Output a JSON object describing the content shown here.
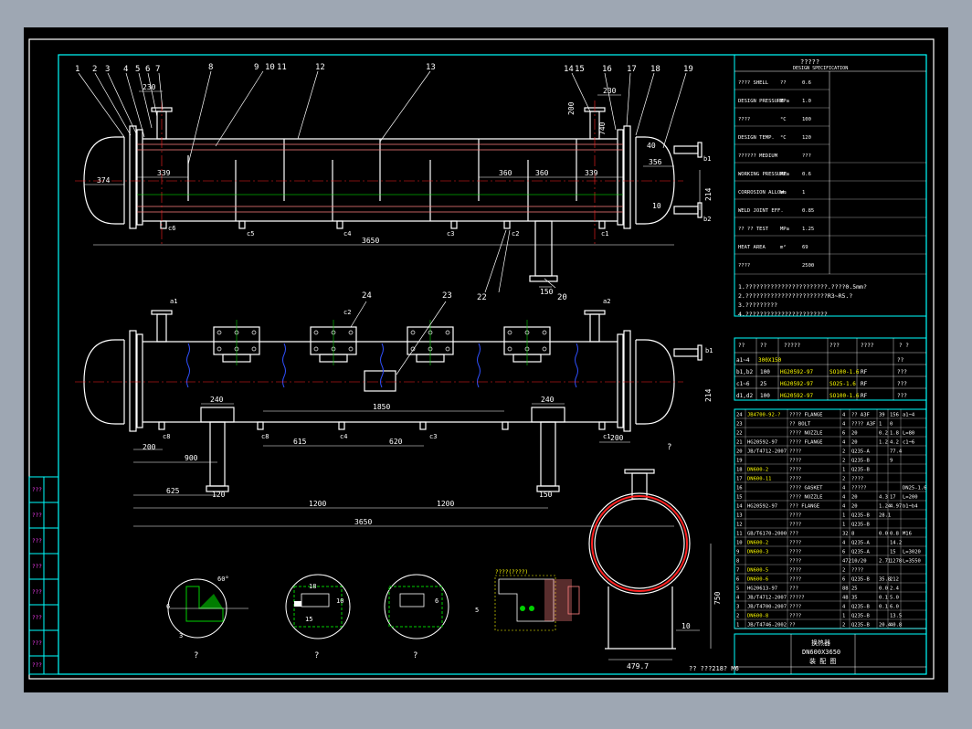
{
  "drawing": {
    "title_line1": "换热器",
    "title_line2": "DN600X3650",
    "title_line3": "装 配 图",
    "scale_note": "?? ???218? M6",
    "question": "?"
  },
  "balloons": [
    "1",
    "2",
    "3",
    "4",
    "5",
    "6",
    "7",
    "8",
    "9",
    "10",
    "11",
    "12",
    "13",
    "14",
    "15",
    "16",
    "17",
    "18",
    "19"
  ],
  "balloons_lower": [
    "24",
    "23",
    "21",
    "22",
    "20"
  ],
  "front_dims": {
    "d374": "374",
    "d339a": "339",
    "d360a": "360",
    "d360b": "360",
    "d339b": "339",
    "d3650": "3650",
    "d230a": "230",
    "d230b": "230",
    "d200": "200",
    "d740": "740",
    "d40": "40",
    "d356": "356",
    "d214": "214",
    "d10": "10",
    "d150": "150",
    "d20": "20"
  },
  "nozzles_top": [
    "c6",
    "c5",
    "c4",
    "c3",
    "c2",
    "c1",
    "b1",
    "b2"
  ],
  "plan_dims": {
    "d240a": "240",
    "d240b": "240",
    "d1850": "1850",
    "d615": "615",
    "d620": "620",
    "d200a": "200",
    "d200b": "200",
    "d900": "900",
    "d625": "625",
    "d120": "120",
    "d150": "150",
    "d1200a": "1200",
    "d1200b": "1200",
    "d3650": "3650",
    "d214": "214"
  },
  "nozzles_plan": [
    "c8",
    "c8",
    "c4",
    "c3",
    "c1",
    "c2",
    "b1",
    "b2",
    "d1",
    "d2",
    "a1",
    "a2"
  ],
  "section_dims": {
    "d479": "479.7",
    "d750": "750",
    "d10": "10"
  },
  "details": {
    "d6a": "6",
    "d3": "3",
    "d60": "60°",
    "d18": "18",
    "d10": "10",
    "d6b": "6",
    "d15": "15",
    "d5": "5"
  },
  "spec": {
    "header": "?????",
    "header_sub": "DESIGN SPECIFICATION",
    "rows": [
      [
        "???? SHELL",
        "??",
        "0.6"
      ],
      [
        "DESIGN PRESSURE",
        "MPa",
        "1.0"
      ],
      [
        "????",
        "°C",
        "100"
      ],
      [
        "DESIGN TEMP.",
        "°C",
        "120"
      ],
      [
        "?????? MEDIUM",
        "",
        "???"
      ],
      [
        "WORKING PRESSURE",
        "MPa",
        "0.6"
      ],
      [
        "CORROSION ALLOW.",
        "mm",
        "1"
      ],
      [
        "WELD JOINT EFF.",
        "",
        "0.85"
      ],
      [
        "?? ?? TEST",
        "MPa",
        "1.25"
      ],
      [
        "HEAT AREA",
        "m²",
        "69"
      ],
      [
        "????",
        "",
        "2500"
      ]
    ],
    "notes": [
      "1.???????????????????????.????0.5mm?",
      "2.???????????????????????R3~R5.?",
      "3.?????????",
      "4.???????????????????????"
    ]
  },
  "nozzle_table": {
    "headers": [
      "??",
      "??",
      "?????",
      "???",
      "????",
      "? ?"
    ],
    "rows": [
      [
        "a1~4",
        "300X150",
        "",
        "",
        "",
        "??"
      ],
      [
        "b1,b2",
        "100",
        "HG20592-97",
        "SO100-1.6",
        "RF",
        "???"
      ],
      [
        "c1~6",
        "25",
        "HG20592-97",
        "SO25-1.6",
        "RF",
        "???"
      ],
      [
        "d1,d2",
        "100",
        "HG20592-97",
        "SO100-1.6",
        "RF",
        "???"
      ]
    ]
  },
  "bom": {
    "rows": [
      [
        "24",
        "JB4700-92-?",
        "???? FLANGE",
        "4",
        "?? A3F",
        "39",
        "156",
        "a1~4"
      ],
      [
        "23",
        "",
        "?? BOLT",
        "4",
        "???? A3F",
        "1",
        "0",
        ""
      ],
      [
        "22",
        "",
        "???? NOZZLE",
        "6",
        "20",
        "0.2",
        "1.8",
        "L=80"
      ],
      [
        "21",
        "HG20592-97",
        "???? FLANGE",
        "4",
        "20",
        "1.2",
        "4.2",
        "c1~6"
      ],
      [
        "20",
        "JB/T4712-2007",
        "????",
        "2",
        "Q235-A",
        "",
        "77.4",
        ""
      ],
      [
        "19",
        "",
        "????",
        "2",
        "Q235-B",
        "",
        "9",
        ""
      ],
      [
        "18",
        "DN600-2",
        "????",
        "1",
        "Q235-B",
        "",
        "",
        ""
      ],
      [
        "17",
        "DN600-11",
        "????",
        "2",
        "????",
        "",
        "",
        ""
      ],
      [
        "16",
        "",
        "???? GASKET",
        "4",
        "?????",
        "",
        "",
        "DN25-1.6"
      ],
      [
        "15",
        "",
        "???? NOZZLE",
        "4",
        "20",
        "4.3",
        "17",
        "L=200"
      ],
      [
        "14",
        "HG20592-97",
        "??? FLANGE",
        "4",
        "20",
        "1.24",
        "4.97",
        "b1~b4"
      ],
      [
        "13",
        "",
        "????",
        "1",
        "Q235-B",
        "28.1",
        "",
        ""
      ],
      [
        "12",
        "",
        "????",
        "1",
        "Q235-B",
        "",
        "",
        ""
      ],
      [
        "11",
        "GB/T6170-2000",
        "???",
        "32",
        "8",
        "0.0",
        "0.8",
        "M16"
      ],
      [
        "10",
        "DN600-2",
        "????",
        "4",
        "Q235-A",
        "",
        "14.2",
        ""
      ],
      [
        "9",
        "DN600-3",
        "????",
        "6",
        "Q235-A",
        "",
        "15",
        "L=3020"
      ],
      [
        "8",
        "",
        "????",
        "472",
        "10/20",
        "2.71",
        "1278",
        "L=3550"
      ],
      [
        "7",
        "DN600-5",
        "????",
        "2",
        "????",
        "",
        "",
        ""
      ],
      [
        "6",
        "DN600-6",
        "????",
        "6",
        "Q235-B",
        "35.8",
        "212",
        ""
      ],
      [
        "5",
        "HG20613-97",
        "???",
        "88",
        "25",
        "0.0",
        "2.4",
        ""
      ],
      [
        "4",
        "JB/T4712-2007",
        "?????",
        "48",
        "35",
        "0.1",
        "5.0",
        ""
      ],
      [
        "3",
        "JB/T4700-2007",
        "????",
        "4",
        "Q235-B",
        "0.1",
        "6.0",
        ""
      ],
      [
        "2",
        "DN600-8",
        "????",
        "1",
        "Q235-B",
        "",
        "13.5",
        ""
      ],
      [
        "1",
        "JB/T4746-2002",
        "??",
        "2",
        "Q235-B",
        "20.4",
        "40.8",
        ""
      ]
    ]
  },
  "colors": {
    "bg": "#000000",
    "line": "#ffffff",
    "border": "#00ffff",
    "centerline": "#ff2020",
    "hatch": "#00d000",
    "blue": "#3050ff",
    "yellow": "#ffff00",
    "magenta": "#ff40ff",
    "tube": "#ff8080"
  }
}
